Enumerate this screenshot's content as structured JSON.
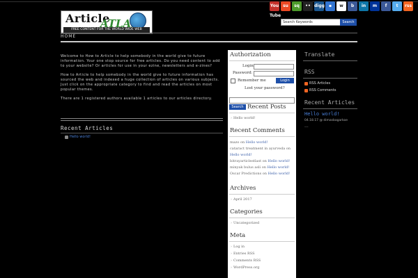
{
  "header": {
    "logo_word": "Article",
    "logo_atlas": "ATLAS",
    "logo_tagline": "FREE CONTENT FOR THE WORLD WIDE WEB",
    "search_placeholder": "Search Keywords",
    "search_button": "Search",
    "social_icons": [
      {
        "name": "youtube-icon",
        "label": "You Tube"
      },
      {
        "name": "stumbleupon-icon",
        "label": "su"
      },
      {
        "name": "squidoo-icon",
        "label": "sq"
      },
      {
        "name": "flickr-icon",
        "label": "••"
      },
      {
        "name": "digg-icon",
        "label": "digg"
      },
      {
        "name": "delicious-icon",
        "label": "▪"
      },
      {
        "name": "wikipedia-icon",
        "label": "w"
      },
      {
        "name": "bookmark-icon",
        "label": "b"
      },
      {
        "name": "linkedin-icon",
        "label": "in"
      },
      {
        "name": "myspace-icon",
        "label": "m"
      },
      {
        "name": "facebook-icon",
        "label": "f"
      },
      {
        "name": "twitter-icon",
        "label": "t"
      },
      {
        "name": "rss-feed-icon",
        "label": "rss"
      }
    ]
  },
  "nav": {
    "home": "HOME"
  },
  "main": {
    "intro_1": "Welcome to How to Article to help somebody in the world give to future information. Your one stop source for free articles. Do you need content to add to your website? Or articles for use in your ezine, newsletters and e-zines?",
    "intro_2": "How to Article to help somebody in the world give to future information has sourced the web and indexed a huge collection of articles on various subjects. Just click on the appropriate category to find and read the articles on most popular themes.",
    "intro_3": "There are 1 registered authors available 1 articles to our articles directory.",
    "recent_heading": "Recent Articles",
    "recent_items": [
      "Hello world!"
    ]
  },
  "midbar": {
    "auth_heading": "Authorization",
    "login_label": "Login:",
    "password_label": "Password:",
    "remember_label": "Remember me",
    "login_button": "Login",
    "lost_password": "Lost your password?",
    "search_button": "Search",
    "recent_posts_heading": "Recent Posts",
    "recent_posts": [
      "Hello world!"
    ],
    "recent_comments_heading": "Recent Comments",
    "comments": [
      {
        "author": "mazo",
        "sep": "on",
        "post": "Hello world!"
      },
      {
        "author": "cataract treatment in ayurveda",
        "sep": "on",
        "post": "Hello world!"
      },
      {
        "author": "bitrayarticlestlast",
        "sep": "on",
        "post": "Hello world!"
      },
      {
        "author": "minyak bulus asli",
        "sep": "on",
        "post": "Hello world!"
      },
      {
        "author": "Oscar Predictions",
        "sep": "on",
        "post": "Hello world!"
      }
    ],
    "archives_heading": "Archives",
    "archives": [
      "April 2017"
    ],
    "categories_heading": "Categories",
    "categories": [
      "Uncategorized"
    ],
    "meta_heading": "Meta",
    "meta": [
      "Log in",
      "Entries RSS",
      "Comments RSS",
      "WordPress.org"
    ]
  },
  "rightbar": {
    "translate_heading": "Translate",
    "rss_heading": "RSS",
    "rss_items": [
      "RSS Articles",
      "RSS Comments"
    ],
    "recent_heading": "Recent Articles",
    "recent_title": "Hello world!",
    "recent_meta": "04.18.17 @ dimasbagarkoe",
    "recent_more": "..."
  }
}
